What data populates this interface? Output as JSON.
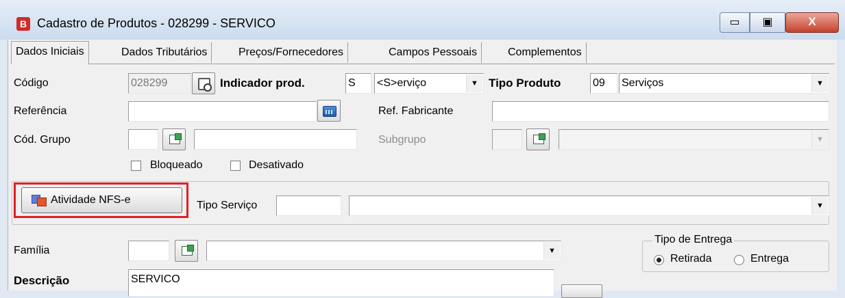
{
  "window": {
    "app_letter": "B",
    "title": "Cadastro de Produtos - 028299 - SERVICO",
    "minimize_glyph": "▭",
    "maximize_glyph": "▣",
    "close_glyph": "X"
  },
  "tabs": [
    {
      "label": "Dados Iniciais",
      "active": true
    },
    {
      "label": "Dados Tributários",
      "active": false
    },
    {
      "label": "Preços/Fornecedores",
      "active": false
    },
    {
      "label": "Campos Pessoais",
      "active": false
    },
    {
      "label": "Complementos",
      "active": false
    }
  ],
  "form": {
    "codigo": {
      "label": "Código",
      "value": "028299"
    },
    "indicador": {
      "label": "Indicador prod.",
      "code": "S",
      "selected": "<S>erviço"
    },
    "tipo_produto": {
      "label": "Tipo Produto",
      "code": "09",
      "selected": "Serviços"
    },
    "referencia": {
      "label": "Referência",
      "value": ""
    },
    "ref_fabricante": {
      "label": "Ref. Fabricante",
      "value": ""
    },
    "cod_grupo": {
      "label": "Cód. Grupo",
      "code": "",
      "name": ""
    },
    "subgrupo": {
      "label": "Subgrupo",
      "code": "",
      "selected": ""
    },
    "bloqueado": {
      "label": "Bloqueado",
      "checked": false
    },
    "desativado": {
      "label": "Desativado",
      "checked": false
    },
    "atividade_nfse": {
      "label": "Atividade NFS-e"
    },
    "tipo_servico": {
      "label": "Tipo Serviço",
      "code": "",
      "selected": ""
    },
    "familia": {
      "label": "Família",
      "code": "",
      "selected": ""
    },
    "descricao": {
      "label": "Descrição",
      "value": "SERVICO"
    },
    "tipo_entrega": {
      "label": "Tipo de Entrega",
      "options": [
        {
          "label": "Retirada",
          "selected": true
        },
        {
          "label": "Entrega",
          "selected": false
        }
      ]
    }
  },
  "colors": {
    "highlight": "#e31e24",
    "close_button": "#c5412c",
    "app_icon": "#d12b2b"
  },
  "icons": {
    "search": "search-icon",
    "calculator": "calculator-icon",
    "lookup": "lookup-icon",
    "nfse": "nfse-icon"
  }
}
